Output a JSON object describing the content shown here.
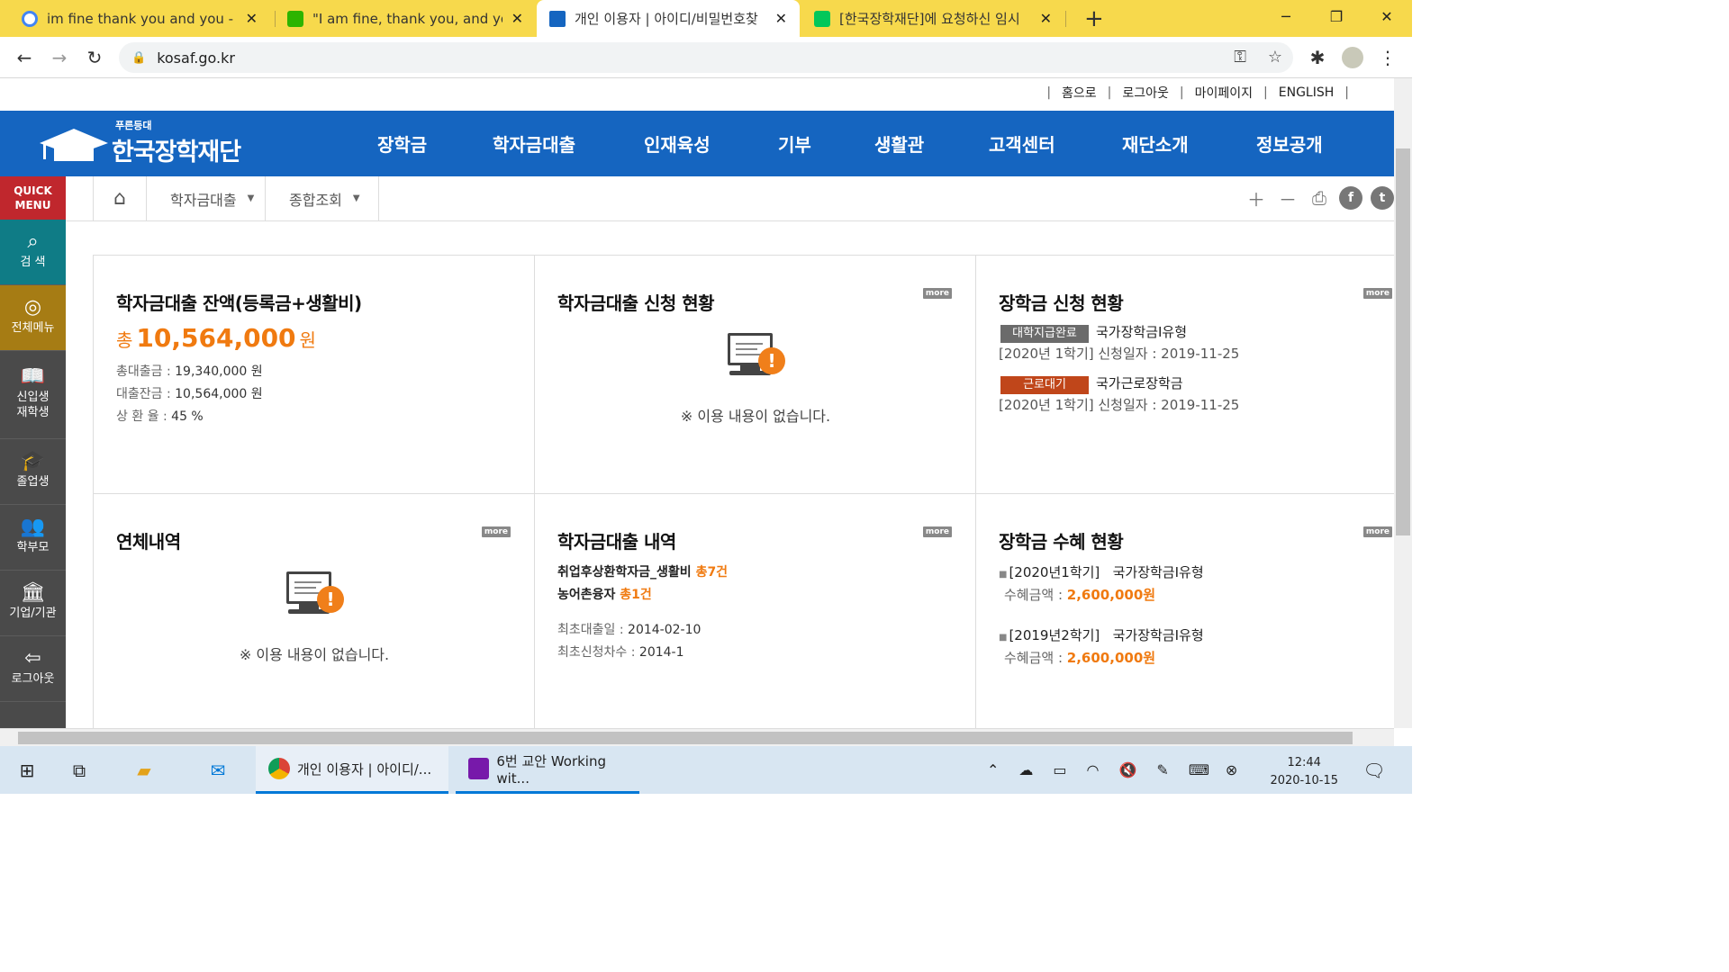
{
  "browser": {
    "tabs": [
      {
        "title": "im fine thank you and you - Go",
        "favicon": "google-icon",
        "color": "#4285f4"
      },
      {
        "title": "\"I am fine, thank you, and you?",
        "favicon": "blog-icon",
        "color": "#2db400"
      },
      {
        "title": "개인 이용자 | 아이디/비밀번호찾",
        "favicon": "kosaf-icon",
        "color": "#1565c0"
      },
      {
        "title": "[한국장학재단]에 요청하신 임시",
        "favicon": "naver-mail-icon",
        "color": "#03c75a"
      }
    ],
    "new_tab": "+",
    "url": "kosaf.go.kr"
  },
  "utility": {
    "home": "홈으로",
    "logout": "로그아웃",
    "mypage": "마이페이지",
    "english": "ENGLISH"
  },
  "logo": {
    "sub": "푸른등대",
    "main": "한국장학재단"
  },
  "gnb": [
    "장학금",
    "학자금대출",
    "인재육성",
    "기부",
    "생활관",
    "고객센터",
    "재단소개",
    "정보공개"
  ],
  "quick": {
    "head_line1": "QUICK",
    "head_line2": "MENU",
    "items": [
      {
        "label": "검 색",
        "icon": "search-icon"
      },
      {
        "label": "전체메뉴",
        "icon": "compass-icon"
      },
      {
        "label1": "신입생",
        "label2": "재학생",
        "icon": "book-icon"
      },
      {
        "label": "졸업생",
        "icon": "graduation-cap-icon"
      },
      {
        "label": "학부모",
        "icon": "parents-icon"
      },
      {
        "label": "기업/기관",
        "icon": "institution-icon"
      },
      {
        "label": "로그아웃",
        "icon": "logout-icon"
      }
    ]
  },
  "breadcrumb": {
    "item1": "학자금대출",
    "item2": "종합조회"
  },
  "more_label": "more",
  "balance": {
    "title": "학자금대출 잔액(등록금+생활비)",
    "total_prefix": "총",
    "total_value": "10,564,000",
    "total_unit": "원",
    "rows": [
      {
        "key": "총대출금 : ",
        "value": "19,340,000 원"
      },
      {
        "key": "대출잔금 : ",
        "value": "10,564,000 원"
      },
      {
        "key": "상 환 율 : ",
        "value": "45 %"
      }
    ]
  },
  "loan_apply": {
    "title": "학자금대출 신청 현황",
    "empty": "※ 이용 내용이 없습니다."
  },
  "scholarship_apply": {
    "title": "장학금 신청 현황",
    "items": [
      {
        "badge": "대학지급완료",
        "badge_color": "#6b6b6b",
        "name": "국가장학금Ⅰ유형",
        "date": "[2020년 1학기] 신청일자 : 2019-11-25"
      },
      {
        "badge": "근로대기",
        "badge_color": "#c0461a",
        "name": "국가근로장학금",
        "date": "[2020년 1학기] 신청일자 : 2019-11-25"
      }
    ]
  },
  "overdue": {
    "title": "연체내역",
    "empty": "※ 이용 내용이 없습니다."
  },
  "loan_history": {
    "title": "학자금대출 내역",
    "lines": [
      {
        "label": "취업후상환학자금_생활비 ",
        "count": "총7건"
      },
      {
        "label": "농어촌융자 ",
        "count": "총1건"
      }
    ],
    "rows": [
      {
        "key": "최초대출일 : ",
        "value": "2014-02-10"
      },
      {
        "key": "최초신청차수 : ",
        "value": "2014-1"
      }
    ]
  },
  "scholarship_received": {
    "title": "장학금 수혜 현황",
    "items": [
      {
        "term": "[2020년1학기]",
        "name": "국가장학금Ⅰ유형",
        "amount_label": "수혜금액 : ",
        "amount": "2,600,000원"
      },
      {
        "term": "[2019년2학기]",
        "name": "국가장학금Ⅰ유형",
        "amount_label": "수혜금액 : ",
        "amount": "2,600,000원"
      }
    ]
  },
  "taskbar": {
    "chrome_app": "개인 이용자 | 아이디/...",
    "onenote_app": "6번 교안 Working wit...",
    "time": "12:44",
    "date": "2020-10-15"
  }
}
